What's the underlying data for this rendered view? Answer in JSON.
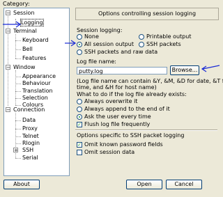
{
  "category_label": "Category:",
  "tree": [
    {
      "label": "Session",
      "expander": "−"
    },
    {
      "label": "Logging",
      "selected": true
    },
    {
      "label": "Terminal",
      "expander": "−"
    },
    {
      "label": "Keyboard"
    },
    {
      "label": "Bell"
    },
    {
      "label": "Features"
    },
    {
      "label": "Window",
      "expander": "−"
    },
    {
      "label": "Appearance"
    },
    {
      "label": "Behaviour"
    },
    {
      "label": "Translation"
    },
    {
      "label": "Selection"
    },
    {
      "label": "Colours"
    },
    {
      "label": "Connection",
      "expander": "−"
    },
    {
      "label": "Data"
    },
    {
      "label": "Proxy"
    },
    {
      "label": "Telnet"
    },
    {
      "label": "Rlogin"
    },
    {
      "label": "SSH",
      "expander": "+"
    },
    {
      "label": "Serial"
    }
  ],
  "panel": {
    "title": "Options controlling session logging",
    "session_logging_label": "Session logging:",
    "radios": {
      "none": "None",
      "printable": "Printable output",
      "all": "All session output",
      "ssh": "SSH packets",
      "ssh_raw": "SSH packets and raw data"
    },
    "selected_logging": "all",
    "log_file_name_label": "Log file name:",
    "log_file_value": "putty.log",
    "browse_label": "Browse...",
    "hint_line1": "(Log file name can contain &Y, &M, &D for date, &T for",
    "hint_line2": "time, and &H for host name)",
    "exists_label": "What to do if the log file already exists:",
    "exists_options": {
      "overwrite": "Always overwrite it",
      "append": "Always append to the end of it",
      "ask": "Ask the user every time"
    },
    "selected_exists": "ask",
    "flush_label": "Flush log file frequently",
    "flush_checked": true,
    "ssh_group_label": "Options specific to SSH packet logging",
    "omit_password_label": "Omit known password fields",
    "omit_password_checked": true,
    "omit_data_label": "Omit session data",
    "omit_data_checked": false
  },
  "buttons": {
    "about": "About",
    "open": "Open",
    "cancel": "Cancel"
  },
  "colors": {
    "annotation_arrow": "#1a2bd6",
    "dialog_bg": "#ece9d8"
  }
}
